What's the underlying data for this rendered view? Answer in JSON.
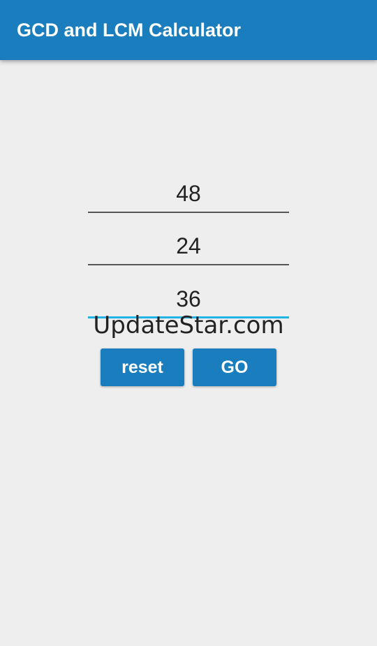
{
  "appbar": {
    "title": "GCD and LCM Calculator",
    "color": "#1a7dbd"
  },
  "inputs": [
    {
      "value": "48"
    },
    {
      "value": "24"
    },
    {
      "value": "36"
    }
  ],
  "watermark": "UpdateStar.com",
  "buttons": {
    "reset_label": "reset",
    "go_label": "GO"
  },
  "colors": {
    "accent": "#1a7dbd",
    "focus_underline": "#1fb3e6",
    "background": "#eeeeee"
  }
}
